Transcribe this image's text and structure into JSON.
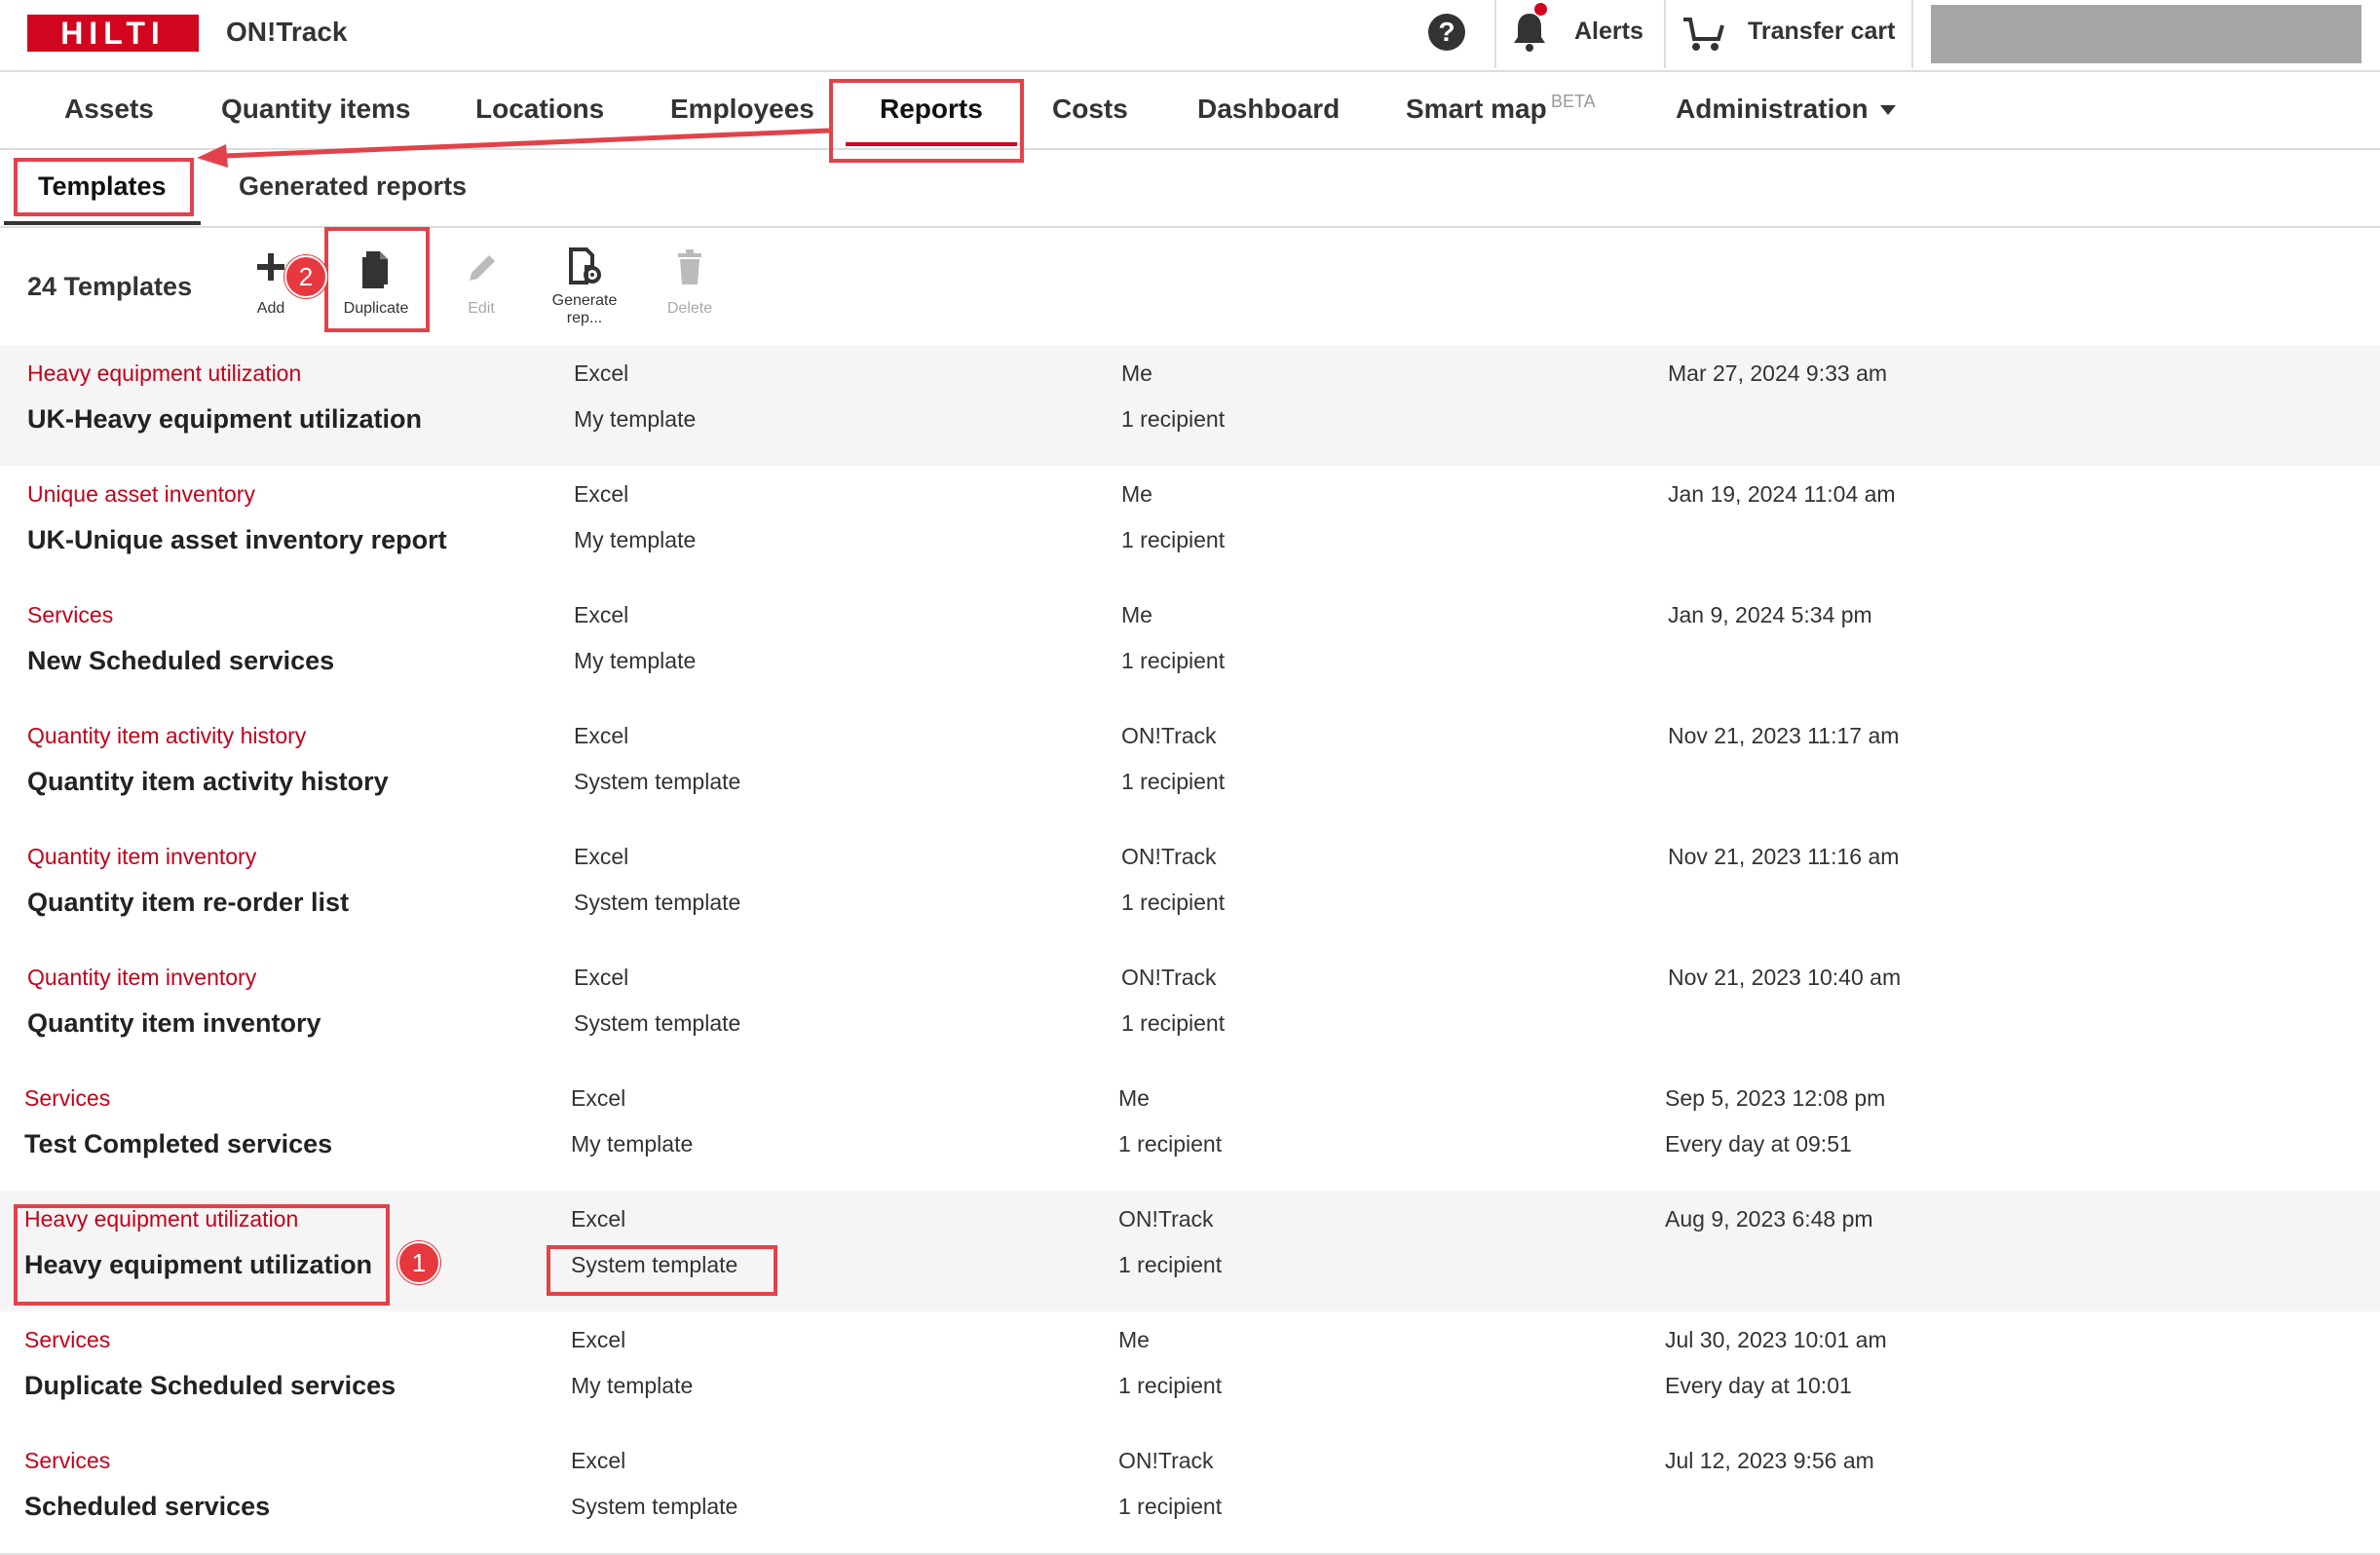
{
  "header": {
    "logo_text": "HILTI",
    "app_title": "ON!Track",
    "help_glyph": "?",
    "alerts_label": "Alerts",
    "cart_label": "Transfer cart",
    "colors": {
      "brand_red": "#d2051e",
      "callout_red": "#e2424a"
    }
  },
  "nav": {
    "items": [
      "Assets",
      "Quantity items",
      "Locations",
      "Employees",
      "Reports",
      "Costs",
      "Dashboard",
      "Smart map",
      "Administration"
    ],
    "beta_label": "BETA",
    "active": "Reports"
  },
  "subnav": {
    "templates": "Templates",
    "generated": "Generated reports"
  },
  "toolbar": {
    "count_label": "24 Templates",
    "add": "Add",
    "duplicate": "Duplicate",
    "edit": "Edit",
    "generate": "Generate rep...",
    "delete": "Delete"
  },
  "callouts": {
    "one": "1",
    "two": "2"
  },
  "rows": [
    {
      "type": "Heavy equipment utilization",
      "name": "UK-Heavy equipment utilization",
      "format": "Excel",
      "template": "My template",
      "owner": "Me",
      "recipients": "1 recipient",
      "date": "Mar 27, 2024 9:33 am",
      "schedule": ""
    },
    {
      "type": "Unique asset inventory",
      "name": "UK-Unique asset inventory report",
      "format": "Excel",
      "template": "My template",
      "owner": "Me",
      "recipients": "1 recipient",
      "date": "Jan 19, 2024 11:04 am",
      "schedule": ""
    },
    {
      "type": "Services",
      "name": "New Scheduled services",
      "format": "Excel",
      "template": "My template",
      "owner": "Me",
      "recipients": "1 recipient",
      "date": "Jan 9, 2024 5:34 pm",
      "schedule": ""
    },
    {
      "type": "Quantity item activity history",
      "name": "Quantity item activity history",
      "format": "Excel",
      "template": "System template",
      "owner": "ON!Track",
      "recipients": "1 recipient",
      "date": "Nov 21, 2023 11:17 am",
      "schedule": ""
    },
    {
      "type": "Quantity item inventory",
      "name": "Quantity item re-order list",
      "format": "Excel",
      "template": "System template",
      "owner": "ON!Track",
      "recipients": "1 recipient",
      "date": "Nov 21, 2023 11:16 am",
      "schedule": ""
    },
    {
      "type": "Quantity item inventory",
      "name": "Quantity item inventory",
      "format": "Excel",
      "template": "System template",
      "owner": "ON!Track",
      "recipients": "1 recipient",
      "date": "Nov 21, 2023 10:40 am",
      "schedule": ""
    },
    {
      "type": "Services",
      "name": "Test Completed services",
      "format": "Excel",
      "template": "My template",
      "owner": "Me",
      "recipients": "1 recipient",
      "date": "Sep 5, 2023 12:08 pm",
      "schedule": "Every day at 09:51"
    },
    {
      "type": "Heavy equipment utilization",
      "name": "Heavy equipment utilization",
      "format": "Excel",
      "template": "System template",
      "owner": "ON!Track",
      "recipients": "1 recipient",
      "date": "Aug 9, 2023 6:48 pm",
      "schedule": ""
    },
    {
      "type": "Services",
      "name": "Duplicate Scheduled services",
      "format": "Excel",
      "template": "My template",
      "owner": "Me",
      "recipients": "1 recipient",
      "date": "Jul 30, 2023 10:01 am",
      "schedule": "Every day at 10:01"
    },
    {
      "type": "Services",
      "name": "Scheduled services",
      "format": "Excel",
      "template": "System template",
      "owner": "ON!Track",
      "recipients": "1 recipient",
      "date": "Jul 12, 2023 9:56 am",
      "schedule": ""
    }
  ]
}
